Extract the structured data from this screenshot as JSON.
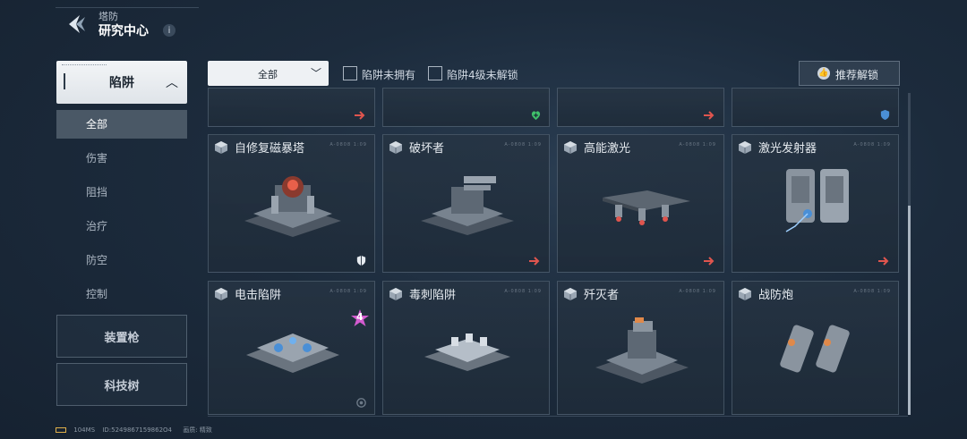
{
  "header": {
    "subtitle": "塔防",
    "title": "研究中心",
    "info_glyph": "i"
  },
  "sidebar": {
    "category": "陷阱",
    "sub_items": [
      "全部",
      "伤害",
      "阻挡",
      "治疗",
      "防空",
      "控制"
    ],
    "categories": [
      "装置枪",
      "科技树"
    ]
  },
  "filters": {
    "dropdown": "全部",
    "check_not_owned": "陷阱未拥有",
    "check_lv4_locked": "陷阱4级未解锁",
    "recommend": "推荐解锁"
  },
  "cards": [
    {
      "name": "自修复磁暴塔",
      "serial": "A-0808 1:09",
      "badge": "shield"
    },
    {
      "name": "破坏者",
      "serial": "A-0808 1:09",
      "badge": "arrow"
    },
    {
      "name": "高能激光",
      "serial": "A-0808 1:09",
      "badge": "arrow"
    },
    {
      "name": "激光发射器",
      "serial": "A-0808 1:09",
      "badge": "arrow"
    },
    {
      "name": "电击陷阱",
      "serial": "A-0808 1:09",
      "badge": "gear",
      "level": "4"
    },
    {
      "name": "毒刺陷阱",
      "serial": "A-0808 1:09",
      "badge": "none"
    },
    {
      "name": "歼灭者",
      "serial": "A-0808 1:09",
      "badge": "none"
    },
    {
      "name": "战防炮",
      "serial": "A-0808 1:09",
      "badge": "none"
    }
  ],
  "footer": {
    "ping": "104MS",
    "id": "ID:5249867159862O4",
    "quality": "画质: 精致"
  },
  "colors": {
    "accent_red": "#e0554e",
    "accent_green": "#3fbf6a",
    "accent_blue": "#4a8fd6",
    "level_pink": "#d35bd0"
  }
}
